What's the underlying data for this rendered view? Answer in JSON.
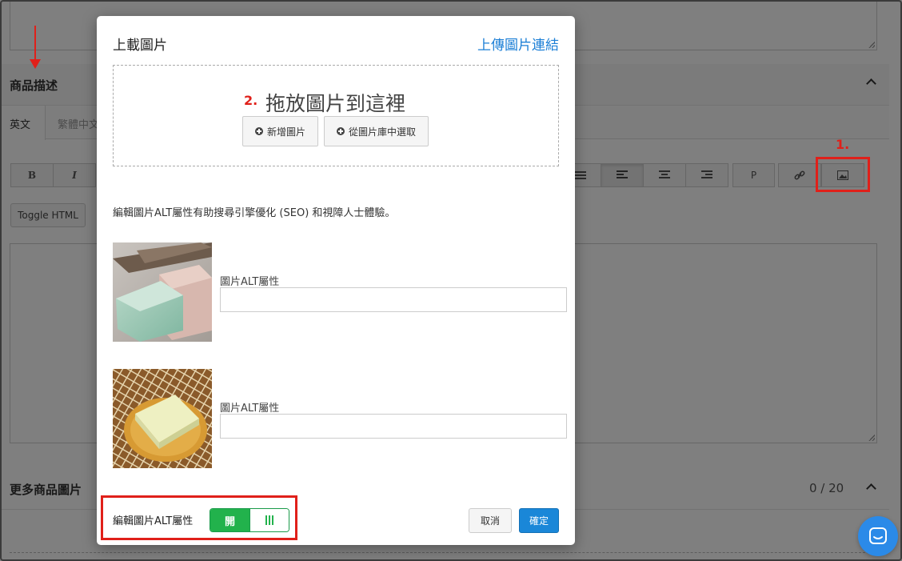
{
  "background": {
    "section_title": "商品描述",
    "tabs": [
      {
        "label": "英文"
      },
      {
        "label": "繁體中文"
      }
    ],
    "toolbar": {
      "bold": "B",
      "italic": "I",
      "paragraph": "P"
    },
    "toggle_html_label": "Toggle HTML",
    "more_images_title": "更多商品圖片",
    "more_images_count": "0 / 20"
  },
  "annotations": {
    "step1": "1.",
    "step2": "2."
  },
  "modal": {
    "title": "上載圖片",
    "upload_link": "上傳圖片連結",
    "dropzone_text": "拖放圖片到這裡",
    "add_image_button": "新增圖片",
    "library_button": "從圖片庫中選取",
    "alt_note": "編輯圖片ALT屬性有助搜尋引擎優化 (SEO) 和視障人士體驗。",
    "images": [
      {
        "alt_label": "圖片ALT屬性",
        "alt_value": ""
      },
      {
        "alt_label": "圖片ALT屬性",
        "alt_value": ""
      }
    ],
    "footer": {
      "alt_toggle_label": "編輯圖片ALT屬性",
      "toggle_state": "開",
      "cancel_button": "取消",
      "confirm_button": "確定"
    }
  },
  "colors": {
    "accent_blue": "#1a87d8",
    "toggle_green": "#22b24c",
    "annotation_red": "#e0201a",
    "chat_blue": "#2b8ae8"
  }
}
